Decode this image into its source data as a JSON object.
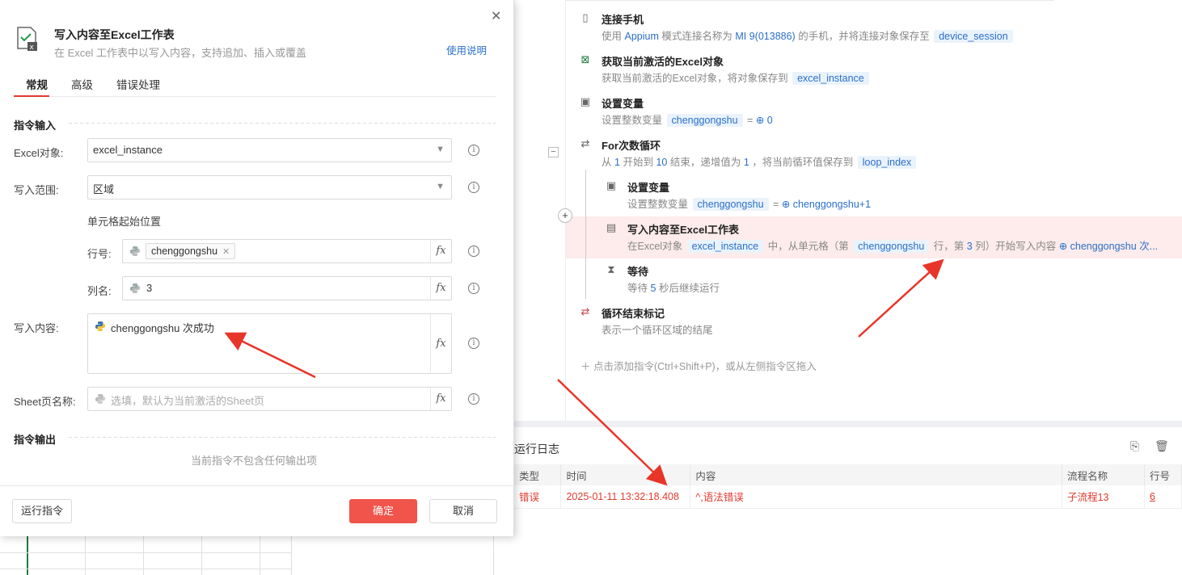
{
  "flow": {
    "steps": [
      {
        "title": "连接手机",
        "d1": "使用",
        "d2": "Appium",
        "d3": "模式连接名称为",
        "d4": "MI 9(013886)",
        "d5": "的手机，并将连接对象保存至",
        "d6": "device_session"
      },
      {
        "title": "获取当前激活的Excel对象",
        "d1": "获取当前激活的Excel对象，将对象保存到",
        "d2": "excel_instance"
      },
      {
        "title": "设置变量",
        "d1": "设置整数变量",
        "d2": "chenggongshu",
        "d3": "=",
        "d4": "0"
      },
      {
        "title": "For次数循环",
        "d1": "从",
        "d2": "1",
        "d3": "开始到",
        "d4": "10",
        "d5": "结束，递增值为",
        "d6": "1",
        "d7": "，将当前循环值保存到",
        "d8": "loop_index"
      },
      {
        "title": "设置变量",
        "d1": "设置整数变量",
        "d2": "chenggongshu",
        "d3": "=",
        "d4": "chenggongshu+1"
      },
      {
        "title": "写入内容至Excel工作表",
        "d1": "在Excel对象",
        "d2": "excel_instance",
        "d3": "中，从单元格（第",
        "d4": "chenggongshu",
        "d5": "行，第",
        "d6": "3",
        "d7": "列）开始写入内容",
        "d8": "chenggongshu 次..."
      },
      {
        "title": "等待",
        "d1": "等待",
        "d2": "5",
        "d3": "秒后继续运行"
      },
      {
        "title": "循环结束标记",
        "d1": "表示一个循环区域的结尾"
      }
    ],
    "add_hint": "点击添加指令(Ctrl+Shift+P)，或从左侧指令区拖入"
  },
  "log": {
    "title": "运行日志",
    "columns": [
      "类型",
      "时间",
      "内容",
      "流程名称",
      "行号"
    ],
    "rows": [
      {
        "type": "错误",
        "time": "2025-01-11 13:32:18.408",
        "content": "^,语法错误",
        "flow": "子流程13",
        "line": "6"
      }
    ]
  },
  "dialog": {
    "title": "写入内容至Excel工作表",
    "subtitle": "在 Excel 工作表中以写入内容，支持追加、插入或覆盖",
    "help": "使用说明",
    "tabs": [
      "常规",
      "高级",
      "错误处理"
    ],
    "section_input": "指令输入",
    "section_output": "指令输出",
    "excel_label": "Excel对象:",
    "excel_value": "excel_instance",
    "range_label": "写入范围:",
    "range_value": "区域",
    "cell_start": "单元格起始位置",
    "row_label": "行号:",
    "row_chip": "chenggongshu",
    "col_label": "列名:",
    "col_value": "3",
    "content_label": "写入内容:",
    "content_value": "chenggongshu 次成功",
    "sheet_label": "Sheet页名称:",
    "sheet_placeholder": "选填，默认为当前激活的Sheet页",
    "no_output": "当前指令不包含任何输出项",
    "run_btn": "运行指令",
    "ok_btn": "确定",
    "cancel_btn": "取消"
  },
  "colors": {
    "accent": "#f0544b",
    "link": "#2a6fc9",
    "error": "#e23a2e"
  }
}
